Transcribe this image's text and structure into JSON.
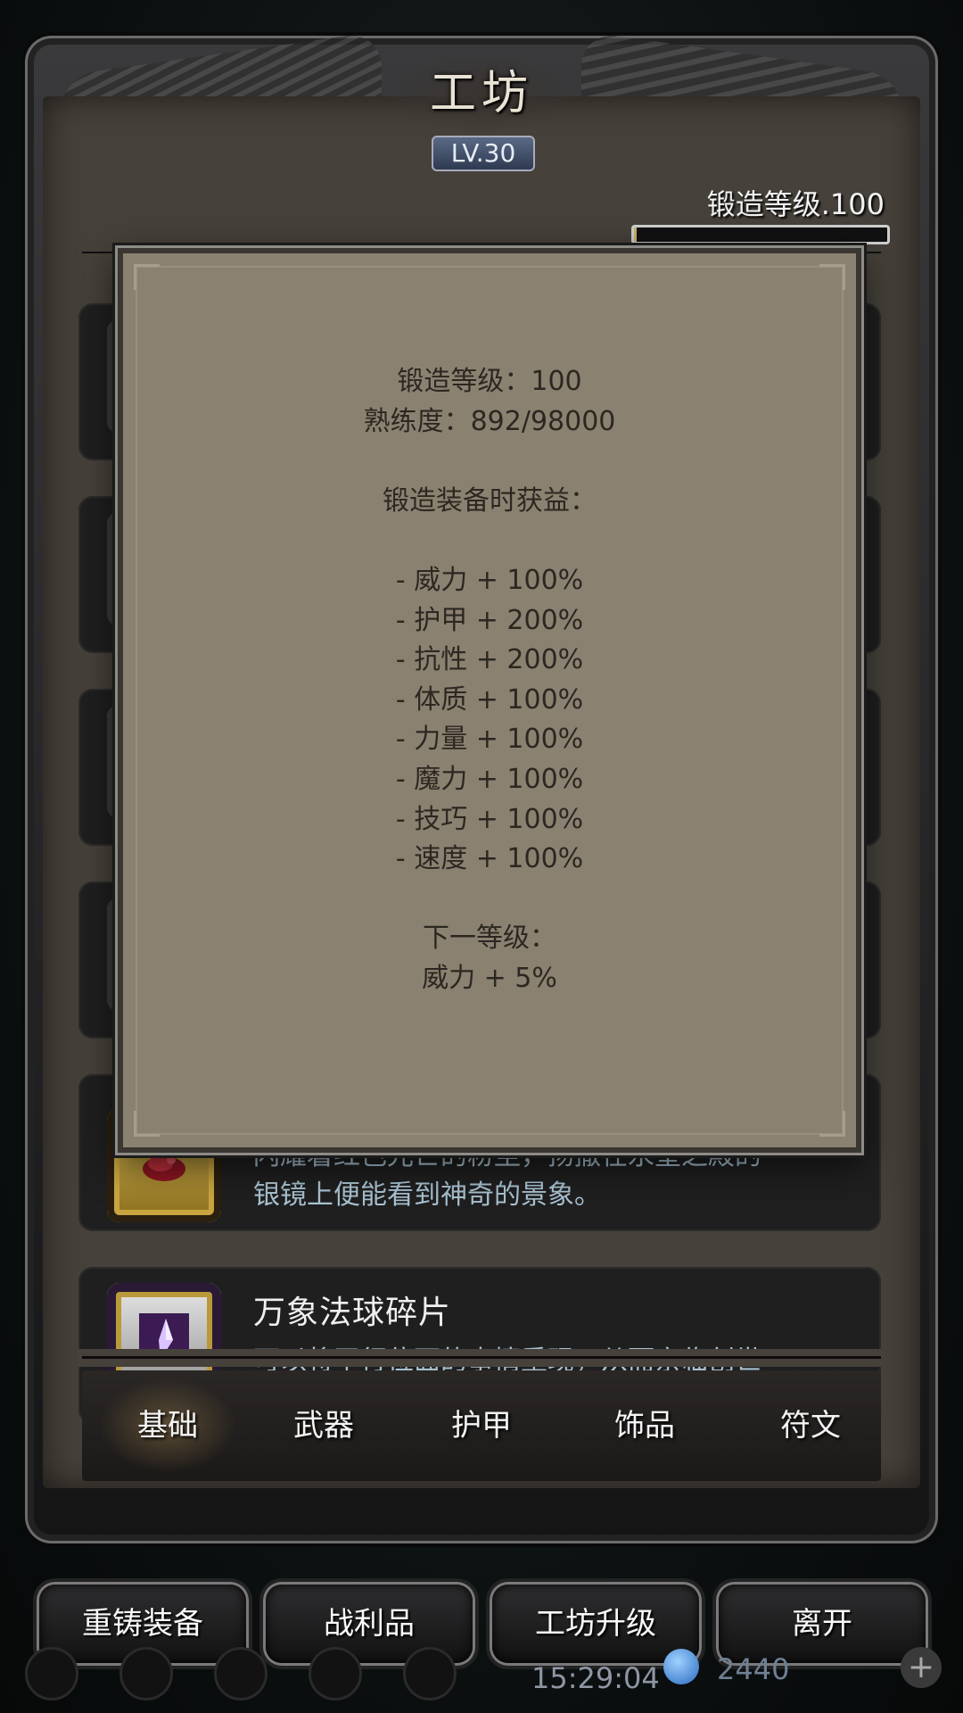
{
  "header": {
    "title": "工坊",
    "level_badge": "LV.30",
    "forge_level": "锻造等级.100",
    "forge_progress": 0.009
  },
  "items": [
    {
      "name": "",
      "desc": "闪耀着红色光芒的粉尘，扬撒在永望之殿的\n银镜上便能看到神奇的景象。",
      "icon": "red-dust-icon"
    },
    {
      "name": "万象法球碎片",
      "desc": "可以将平行位面的事情重现，从而亲临创世",
      "icon": "purple-crystal-icon"
    }
  ],
  "popup": {
    "lines": [
      "锻造等级：100",
      "熟练度：892/98000",
      "",
      "锻造装备时获益：",
      "",
      "- 威力 + 100%",
      "- 护甲 + 200%",
      "- 抗性 + 200%",
      "- 体质 + 100%",
      "- 力量 + 100%",
      "- 魔力 + 100%",
      "- 技巧 + 100%",
      "- 速度 + 100%",
      "",
      "下一等级：",
      "威力 + 5%"
    ]
  },
  "tabs": [
    "基础",
    "武器",
    "护甲",
    "饰品",
    "符文"
  ],
  "buttons": [
    "重铸装备",
    "战利品",
    "工坊升级",
    "离开"
  ],
  "status": {
    "clock": "15:29:04",
    "gems": "2440"
  },
  "colors": {
    "popup_bg": "#8b8171",
    "popup_text": "#2c2720",
    "item_desc": "#a9c2d0"
  }
}
